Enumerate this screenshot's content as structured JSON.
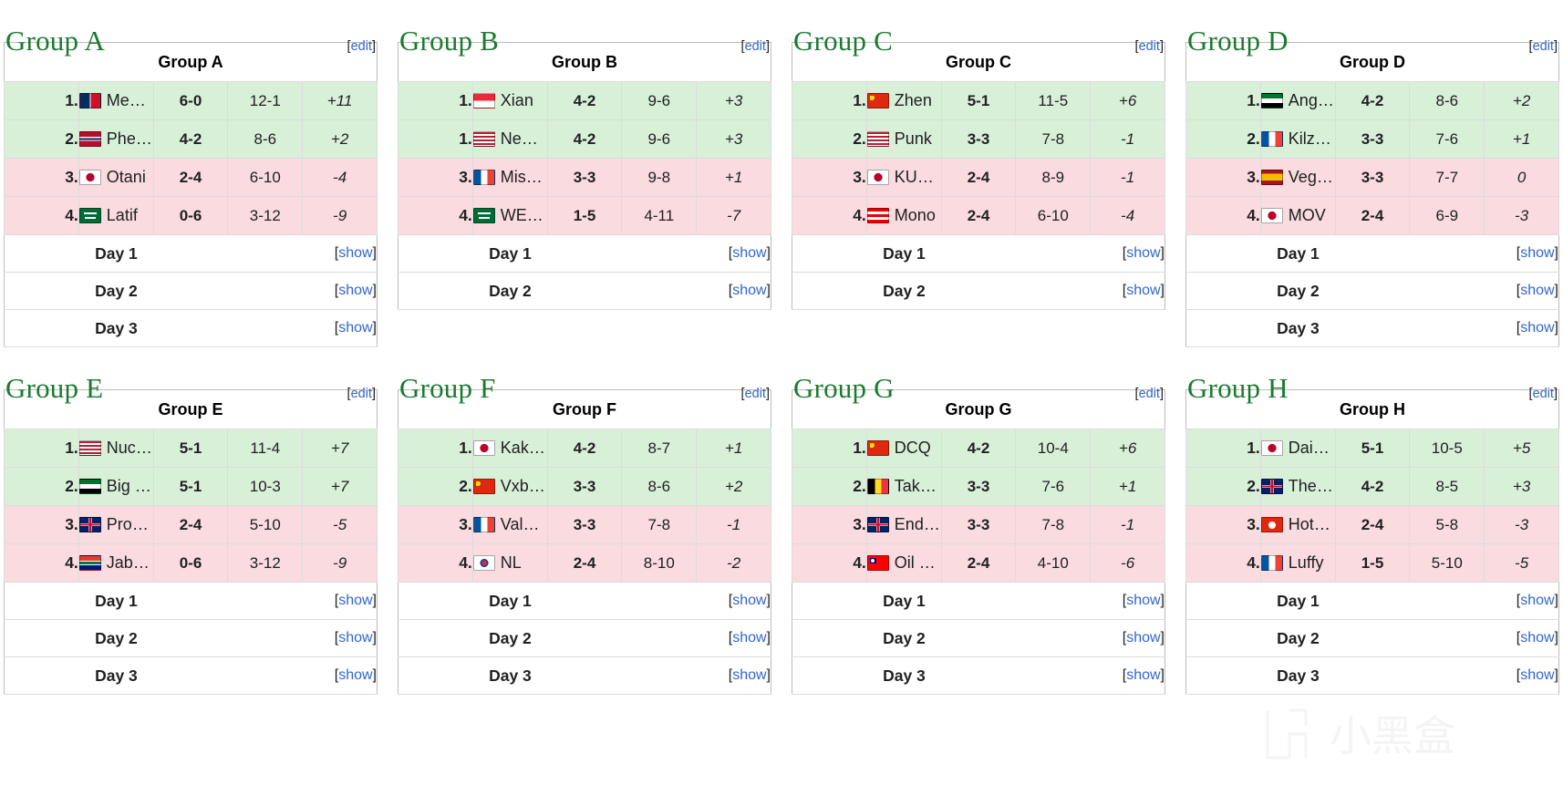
{
  "labels": {
    "edit": "[edit]",
    "edit_open": "[",
    "edit_text": "edit",
    "edit_close": "]",
    "show_open": "[",
    "show_text": "show",
    "show_close": "]"
  },
  "colors": {
    "title_green": "#1a7a2e",
    "link_blue": "#3366cc",
    "advance_bg": "#d8f0d8",
    "eliminated_bg": "#fadbdf",
    "table_border": "#bcbcbc"
  },
  "watermark": {
    "text": "小黑盒"
  },
  "groups": [
    {
      "title": "Group A",
      "header": "Group A",
      "edit": "[edit]",
      "rows": [
        {
          "rank": "1.",
          "flag": "flag-dominican-republic",
          "player": "MenaRD",
          "matches": "6-0",
          "games": "12-1",
          "diff": "+11",
          "status": "adv"
        },
        {
          "rank": "2.",
          "flag": "flag-norway",
          "player": "Phenom",
          "matches": "4-2",
          "games": "8-6",
          "diff": "+2",
          "status": "adv"
        },
        {
          "rank": "3.",
          "flag": "flag-japan",
          "player": "Otani",
          "matches": "2-4",
          "games": "6-10",
          "diff": "-4",
          "status": "elim"
        },
        {
          "rank": "4.",
          "flag": "flag-saudi-arabia",
          "player": "Latif",
          "matches": "0-6",
          "games": "3-12",
          "diff": "-9",
          "status": "elim"
        }
      ],
      "days": [
        {
          "label": "Day 1",
          "show": "[show]"
        },
        {
          "label": "Day 2",
          "show": "[show]"
        },
        {
          "label": "Day 3",
          "show": "[show]"
        }
      ]
    },
    {
      "title": "Group B",
      "header": "Group B",
      "edit": "[edit]",
      "rows": [
        {
          "rank": "1.",
          "flag": "flag-singapore",
          "player": "Xian",
          "matches": "4-2",
          "games": "9-6",
          "diff": "+3",
          "status": "adv"
        },
        {
          "rank": "1.",
          "flag": "flag-united-states",
          "player": "Nephew",
          "matches": "4-2",
          "games": "9-6",
          "diff": "+3",
          "status": "adv"
        },
        {
          "rank": "3.",
          "flag": "flag-france",
          "player": "Mister Crimson",
          "matches": "3-3",
          "games": "9-8",
          "diff": "+1",
          "status": "elim"
        },
        {
          "rank": "4.",
          "flag": "flag-saudi-arabia",
          "player": "WESS",
          "matches": "1-5",
          "games": "4-11",
          "diff": "-7",
          "status": "elim"
        }
      ],
      "days": [
        {
          "label": "Day 1",
          "show": "[show]"
        },
        {
          "label": "Day 2",
          "show": "[show]"
        }
      ]
    },
    {
      "title": "Group C",
      "header": "Group C",
      "edit": "[edit]",
      "rows": [
        {
          "rank": "1.",
          "flag": "flag-china",
          "player": "Zhen",
          "matches": "5-1",
          "games": "11-5",
          "diff": "+6",
          "status": "adv"
        },
        {
          "rank": "2.",
          "flag": "flag-united-states",
          "player": "Punk",
          "matches": "3-3",
          "games": "7-8",
          "diff": "-1",
          "status": "adv"
        },
        {
          "rank": "3.",
          "flag": "flag-japan",
          "player": "KUDO",
          "matches": "2-4",
          "games": "8-9",
          "diff": "-1",
          "status": "elim"
        },
        {
          "rank": "4.",
          "flag": "flag-puerto-rico",
          "player": "Mono",
          "matches": "2-4",
          "games": "6-10",
          "diff": "-4",
          "status": "elim"
        }
      ],
      "days": [
        {
          "label": "Day 1",
          "show": "[show]"
        },
        {
          "label": "Day 2",
          "show": "[show]"
        }
      ]
    },
    {
      "title": "Group D",
      "header": "Group D",
      "edit": "[edit]",
      "rows": [
        {
          "rank": "1.",
          "flag": "flag-united-arab-emirates",
          "player": "AngryBird",
          "matches": "4-2",
          "games": "8-6",
          "diff": "+2",
          "status": "adv"
        },
        {
          "rank": "2.",
          "flag": "flag-france",
          "player": "Kilzyou",
          "matches": "3-3",
          "games": "7-6",
          "diff": "+1",
          "status": "adv"
        },
        {
          "rank": "3.",
          "flag": "flag-spain",
          "player": "VegaPatch",
          "matches": "3-3",
          "games": "7-7",
          "diff": "0",
          "status": "elim"
        },
        {
          "rank": "4.",
          "flag": "flag-japan",
          "player": "MOV",
          "matches": "2-4",
          "games": "6-9",
          "diff": "-3",
          "status": "elim"
        }
      ],
      "days": [
        {
          "label": "Day 1",
          "show": "[show]"
        },
        {
          "label": "Day 2",
          "show": "[show]"
        },
        {
          "label": "Day 3",
          "show": "[show]"
        }
      ]
    },
    {
      "title": "Group E",
      "header": "Group E",
      "edit": "[edit]",
      "rows": [
        {
          "rank": "1.",
          "flag": "flag-united-states",
          "player": "NuckleDu",
          "matches": "5-1",
          "games": "11-4",
          "diff": "+7",
          "status": "adv"
        },
        {
          "rank": "2.",
          "flag": "flag-united-arab-emirates",
          "player": "Big Bird",
          "matches": "5-1",
          "games": "10-3",
          "diff": "+7",
          "status": "adv"
        },
        {
          "rank": "3.",
          "flag": "flag-united-kingdom",
          "player": "Problem X",
          "matches": "2-4",
          "games": "5-10",
          "diff": "-5",
          "status": "elim"
        },
        {
          "rank": "4.",
          "flag": "flag-south-africa",
          "player": "JabhiM",
          "matches": "0-6",
          "games": "3-12",
          "diff": "-9",
          "status": "elim"
        }
      ],
      "days": [
        {
          "label": "Day 1",
          "show": "[show]"
        },
        {
          "label": "Day 2",
          "show": "[show]"
        },
        {
          "label": "Day 3",
          "show": "[show]"
        }
      ]
    },
    {
      "title": "Group F",
      "header": "Group F",
      "edit": "[edit]",
      "rows": [
        {
          "rank": "1.",
          "flag": "flag-japan",
          "player": "Kakeru",
          "matches": "4-2",
          "games": "8-7",
          "diff": "+1",
          "status": "adv"
        },
        {
          "rank": "2.",
          "flag": "flag-china",
          "player": "Vxbao",
          "matches": "3-3",
          "games": "8-6",
          "diff": "+2",
          "status": "adv"
        },
        {
          "rank": "3.",
          "flag": "flag-france",
          "player": "Valmaster",
          "matches": "3-3",
          "games": "7-8",
          "diff": "-1",
          "status": "elim"
        },
        {
          "rank": "4.",
          "flag": "flag-south-korea",
          "player": "NL",
          "matches": "2-4",
          "games": "8-10",
          "diff": "-2",
          "status": "elim"
        }
      ],
      "days": [
        {
          "label": "Day 1",
          "show": "[show]"
        },
        {
          "label": "Day 2",
          "show": "[show]"
        },
        {
          "label": "Day 3",
          "show": "[show]"
        }
      ]
    },
    {
      "title": "Group G",
      "header": "Group G",
      "edit": "[edit]",
      "rows": [
        {
          "rank": "1.",
          "flag": "flag-china",
          "player": "DCQ",
          "matches": "4-2",
          "games": "10-4",
          "diff": "+6",
          "status": "adv"
        },
        {
          "rank": "2.",
          "flag": "flag-belgium",
          "player": "Takamura",
          "matches": "3-3",
          "games": "7-6",
          "diff": "+1",
          "status": "adv"
        },
        {
          "rank": "3.",
          "flag": "flag-united-kingdom",
          "player": "EndingWalker",
          "matches": "3-3",
          "games": "7-8",
          "diff": "-1",
          "status": "elim"
        },
        {
          "rank": "4.",
          "flag": "flag-taiwan",
          "player": "Oil King",
          "matches": "2-4",
          "games": "4-10",
          "diff": "-6",
          "status": "elim"
        }
      ],
      "days": [
        {
          "label": "Day 1",
          "show": "[show]"
        },
        {
          "label": "Day 2",
          "show": "[show]"
        },
        {
          "label": "Day 3",
          "show": "[show]"
        }
      ]
    },
    {
      "title": "Group H",
      "header": "Group H",
      "edit": "[edit]",
      "rows": [
        {
          "rank": "1.",
          "flag": "flag-japan",
          "player": "Daigo Umehara",
          "matches": "5-1",
          "games": "10-5",
          "diff": "+5",
          "status": "adv"
        },
        {
          "rank": "2.",
          "flag": "flag-united-kingdom",
          "player": "The4philzz",
          "matches": "4-2",
          "games": "8-5",
          "diff": "+3",
          "status": "adv"
        },
        {
          "rank": "3.",
          "flag": "flag-hong-kong",
          "player": "HotDog29",
          "matches": "2-4",
          "games": "5-8",
          "diff": "-3",
          "status": "elim"
        },
        {
          "rank": "4.",
          "flag": "flag-france",
          "player": "Luffy",
          "matches": "1-5",
          "games": "5-10",
          "diff": "-5",
          "status": "elim"
        }
      ],
      "days": [
        {
          "label": "Day 1",
          "show": "[show]"
        },
        {
          "label": "Day 2",
          "show": "[show]"
        },
        {
          "label": "Day 3",
          "show": "[show]"
        }
      ]
    }
  ]
}
